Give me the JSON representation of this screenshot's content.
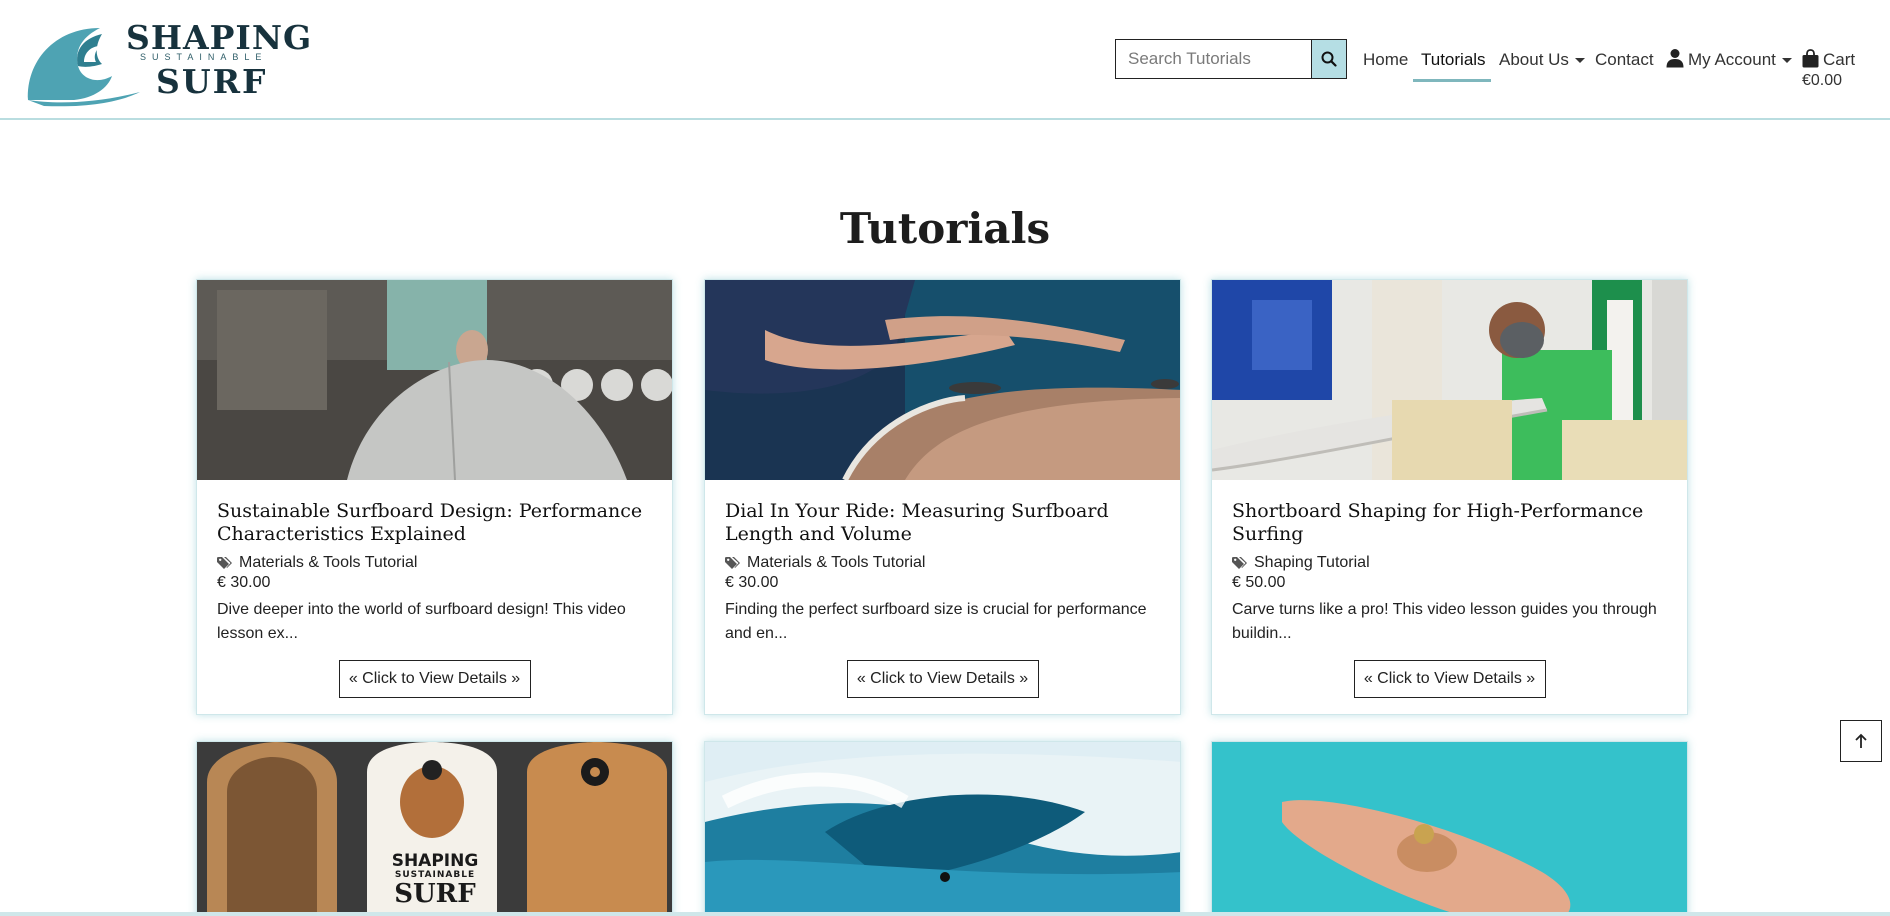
{
  "brand": {
    "line1": "SHAPING",
    "line2": "SUSTAINABLE",
    "line3": "SURF"
  },
  "search": {
    "placeholder": "Search Tutorials"
  },
  "nav": {
    "home": "Home",
    "tutorials": "Tutorials",
    "about": "About Us",
    "contact": "Contact",
    "account": "My Account",
    "cart": "Cart",
    "cart_total": "€0.00"
  },
  "page": {
    "title": "Tutorials"
  },
  "cta_label": "« Click to View Details »",
  "cards": [
    {
      "title": "Sustainable Surfboard Design: Performance Characteristics Explained",
      "category": "Materials & Tools Tutorial",
      "price": "€ 30.00",
      "description": "Dive deeper into the world of surfboard design! This video lesson ex..."
    },
    {
      "title": "Dial In Your Ride: Measuring Surfboard Length and Volume",
      "category": "Materials & Tools Tutorial",
      "price": "€ 30.00",
      "description": "Finding the perfect surfboard size is crucial for performance and en..."
    },
    {
      "title": "Shortboard Shaping for High-Performance Surfing",
      "category": "Shaping Tutorial",
      "price": "€ 50.00",
      "description": "Carve turns like a pro! This video lesson guides you through buildin..."
    }
  ],
  "second_row_board_logo": {
    "line1": "SHAPING",
    "line2": "SUSTAINABLE",
    "line3": "SURF"
  },
  "colors": {
    "accent": "#b5dee4",
    "brand_dark": "#17323d",
    "brand_wave": "#4ea3b3",
    "card_glow": "#6ebec8"
  }
}
